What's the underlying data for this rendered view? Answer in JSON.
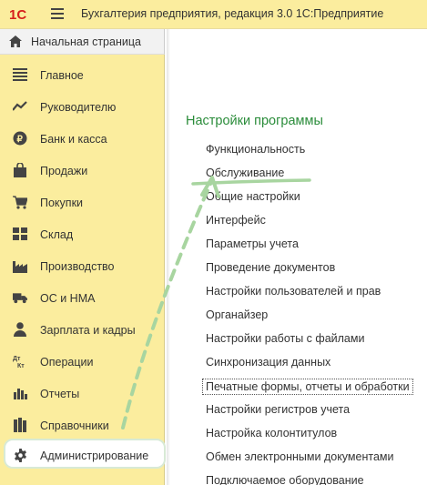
{
  "titlebar": {
    "logo_text": "1С",
    "title": "Бухгалтерия предприятия, редакция 3.0 1С:Предприятие"
  },
  "home": {
    "label": "Начальная страница"
  },
  "sidebar": {
    "items": [
      {
        "label": "Главное",
        "icon": "menu-lines-icon"
      },
      {
        "label": "Руководителю",
        "icon": "trend-chart-icon"
      },
      {
        "label": "Банк и касса",
        "icon": "ruble-coin-icon"
      },
      {
        "label": "Продажи",
        "icon": "shopping-bag-icon"
      },
      {
        "label": "Покупки",
        "icon": "shopping-cart-icon"
      },
      {
        "label": "Склад",
        "icon": "warehouse-grid-icon"
      },
      {
        "label": "Производство",
        "icon": "factory-icon"
      },
      {
        "label": "ОС и НМА",
        "icon": "truck-icon"
      },
      {
        "label": "Зарплата и кадры",
        "icon": "person-icon"
      },
      {
        "label": "Операции",
        "icon": "debit-credit-icon"
      },
      {
        "label": "Отчеты",
        "icon": "bar-chart-icon"
      },
      {
        "label": "Справочники",
        "icon": "books-icon"
      },
      {
        "label": "Администрирование",
        "icon": "gear-icon",
        "active": true
      }
    ]
  },
  "content": {
    "section_title": "Настройки программы",
    "links": [
      "Функциональность",
      "Обслуживание",
      "Общие настройки",
      "Интерфейс",
      "Параметры учета",
      "Проведение документов",
      "Настройки пользователей и прав",
      "Органайзер",
      "Настройки работы с файлами",
      "Синхронизация данных",
      "Печатные формы, отчеты и обработки",
      "Настройки регистров учета",
      "Настройка колонтитулов",
      "Обмен электронными документами",
      "Подключаемое оборудование"
    ]
  },
  "colors": {
    "sidebar_bg": "#fbed9e",
    "section_title": "#2a8c3a",
    "highlight": "#a8d5a0",
    "logo_red": "#d6201c"
  }
}
